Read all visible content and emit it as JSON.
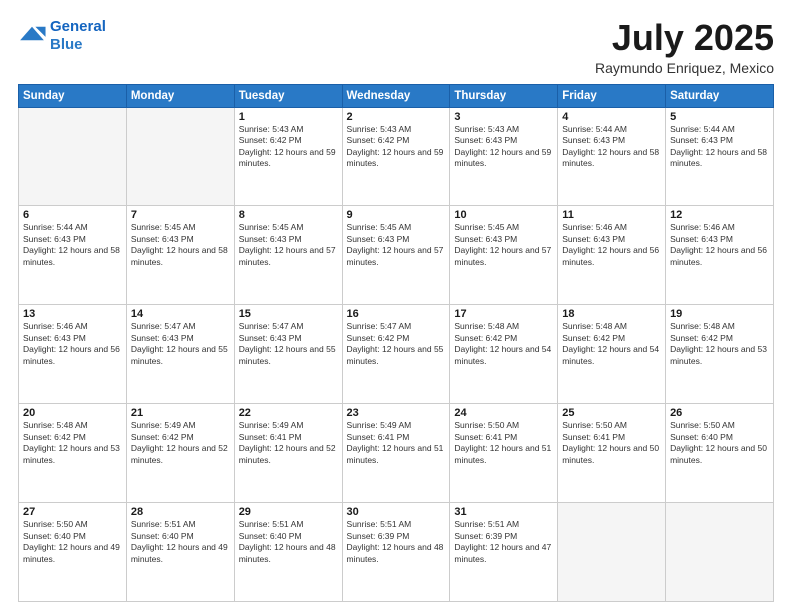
{
  "logo": {
    "line1": "General",
    "line2": "Blue"
  },
  "title": "July 2025",
  "location": "Raymundo Enriquez, Mexico",
  "weekdays": [
    "Sunday",
    "Monday",
    "Tuesday",
    "Wednesday",
    "Thursday",
    "Friday",
    "Saturday"
  ],
  "weeks": [
    [
      {
        "day": "",
        "sunrise": "",
        "sunset": "",
        "daylight": ""
      },
      {
        "day": "",
        "sunrise": "",
        "sunset": "",
        "daylight": ""
      },
      {
        "day": "1",
        "sunrise": "Sunrise: 5:43 AM",
        "sunset": "Sunset: 6:42 PM",
        "daylight": "Daylight: 12 hours and 59 minutes."
      },
      {
        "day": "2",
        "sunrise": "Sunrise: 5:43 AM",
        "sunset": "Sunset: 6:42 PM",
        "daylight": "Daylight: 12 hours and 59 minutes."
      },
      {
        "day": "3",
        "sunrise": "Sunrise: 5:43 AM",
        "sunset": "Sunset: 6:43 PM",
        "daylight": "Daylight: 12 hours and 59 minutes."
      },
      {
        "day": "4",
        "sunrise": "Sunrise: 5:44 AM",
        "sunset": "Sunset: 6:43 PM",
        "daylight": "Daylight: 12 hours and 58 minutes."
      },
      {
        "day": "5",
        "sunrise": "Sunrise: 5:44 AM",
        "sunset": "Sunset: 6:43 PM",
        "daylight": "Daylight: 12 hours and 58 minutes."
      }
    ],
    [
      {
        "day": "6",
        "sunrise": "Sunrise: 5:44 AM",
        "sunset": "Sunset: 6:43 PM",
        "daylight": "Daylight: 12 hours and 58 minutes."
      },
      {
        "day": "7",
        "sunrise": "Sunrise: 5:45 AM",
        "sunset": "Sunset: 6:43 PM",
        "daylight": "Daylight: 12 hours and 58 minutes."
      },
      {
        "day": "8",
        "sunrise": "Sunrise: 5:45 AM",
        "sunset": "Sunset: 6:43 PM",
        "daylight": "Daylight: 12 hours and 57 minutes."
      },
      {
        "day": "9",
        "sunrise": "Sunrise: 5:45 AM",
        "sunset": "Sunset: 6:43 PM",
        "daylight": "Daylight: 12 hours and 57 minutes."
      },
      {
        "day": "10",
        "sunrise": "Sunrise: 5:45 AM",
        "sunset": "Sunset: 6:43 PM",
        "daylight": "Daylight: 12 hours and 57 minutes."
      },
      {
        "day": "11",
        "sunrise": "Sunrise: 5:46 AM",
        "sunset": "Sunset: 6:43 PM",
        "daylight": "Daylight: 12 hours and 56 minutes."
      },
      {
        "day": "12",
        "sunrise": "Sunrise: 5:46 AM",
        "sunset": "Sunset: 6:43 PM",
        "daylight": "Daylight: 12 hours and 56 minutes."
      }
    ],
    [
      {
        "day": "13",
        "sunrise": "Sunrise: 5:46 AM",
        "sunset": "Sunset: 6:43 PM",
        "daylight": "Daylight: 12 hours and 56 minutes."
      },
      {
        "day": "14",
        "sunrise": "Sunrise: 5:47 AM",
        "sunset": "Sunset: 6:43 PM",
        "daylight": "Daylight: 12 hours and 55 minutes."
      },
      {
        "day": "15",
        "sunrise": "Sunrise: 5:47 AM",
        "sunset": "Sunset: 6:43 PM",
        "daylight": "Daylight: 12 hours and 55 minutes."
      },
      {
        "day": "16",
        "sunrise": "Sunrise: 5:47 AM",
        "sunset": "Sunset: 6:42 PM",
        "daylight": "Daylight: 12 hours and 55 minutes."
      },
      {
        "day": "17",
        "sunrise": "Sunrise: 5:48 AM",
        "sunset": "Sunset: 6:42 PM",
        "daylight": "Daylight: 12 hours and 54 minutes."
      },
      {
        "day": "18",
        "sunrise": "Sunrise: 5:48 AM",
        "sunset": "Sunset: 6:42 PM",
        "daylight": "Daylight: 12 hours and 54 minutes."
      },
      {
        "day": "19",
        "sunrise": "Sunrise: 5:48 AM",
        "sunset": "Sunset: 6:42 PM",
        "daylight": "Daylight: 12 hours and 53 minutes."
      }
    ],
    [
      {
        "day": "20",
        "sunrise": "Sunrise: 5:48 AM",
        "sunset": "Sunset: 6:42 PM",
        "daylight": "Daylight: 12 hours and 53 minutes."
      },
      {
        "day": "21",
        "sunrise": "Sunrise: 5:49 AM",
        "sunset": "Sunset: 6:42 PM",
        "daylight": "Daylight: 12 hours and 52 minutes."
      },
      {
        "day": "22",
        "sunrise": "Sunrise: 5:49 AM",
        "sunset": "Sunset: 6:41 PM",
        "daylight": "Daylight: 12 hours and 52 minutes."
      },
      {
        "day": "23",
        "sunrise": "Sunrise: 5:49 AM",
        "sunset": "Sunset: 6:41 PM",
        "daylight": "Daylight: 12 hours and 51 minutes."
      },
      {
        "day": "24",
        "sunrise": "Sunrise: 5:50 AM",
        "sunset": "Sunset: 6:41 PM",
        "daylight": "Daylight: 12 hours and 51 minutes."
      },
      {
        "day": "25",
        "sunrise": "Sunrise: 5:50 AM",
        "sunset": "Sunset: 6:41 PM",
        "daylight": "Daylight: 12 hours and 50 minutes."
      },
      {
        "day": "26",
        "sunrise": "Sunrise: 5:50 AM",
        "sunset": "Sunset: 6:40 PM",
        "daylight": "Daylight: 12 hours and 50 minutes."
      }
    ],
    [
      {
        "day": "27",
        "sunrise": "Sunrise: 5:50 AM",
        "sunset": "Sunset: 6:40 PM",
        "daylight": "Daylight: 12 hours and 49 minutes."
      },
      {
        "day": "28",
        "sunrise": "Sunrise: 5:51 AM",
        "sunset": "Sunset: 6:40 PM",
        "daylight": "Daylight: 12 hours and 49 minutes."
      },
      {
        "day": "29",
        "sunrise": "Sunrise: 5:51 AM",
        "sunset": "Sunset: 6:40 PM",
        "daylight": "Daylight: 12 hours and 48 minutes."
      },
      {
        "day": "30",
        "sunrise": "Sunrise: 5:51 AM",
        "sunset": "Sunset: 6:39 PM",
        "daylight": "Daylight: 12 hours and 48 minutes."
      },
      {
        "day": "31",
        "sunrise": "Sunrise: 5:51 AM",
        "sunset": "Sunset: 6:39 PM",
        "daylight": "Daylight: 12 hours and 47 minutes."
      },
      {
        "day": "",
        "sunrise": "",
        "sunset": "",
        "daylight": ""
      },
      {
        "day": "",
        "sunrise": "",
        "sunset": "",
        "daylight": ""
      }
    ]
  ]
}
